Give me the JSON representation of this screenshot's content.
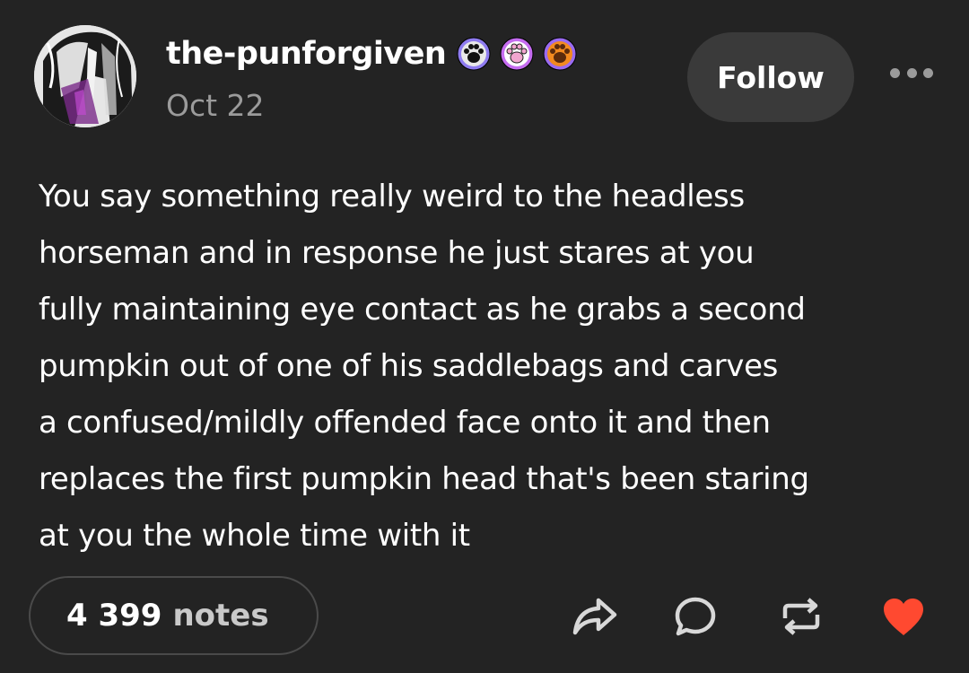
{
  "post": {
    "author": {
      "username": "the-punforgiven",
      "date": "Oct 22",
      "badges": [
        {
          "icon": "paw-badge-black",
          "bg": "#8f7cf0",
          "paw": "#111111"
        },
        {
          "icon": "paw-badge-pink",
          "bg": "#c56cf0",
          "paw": "#f2a6cf"
        },
        {
          "icon": "paw-badge-orange",
          "bg": "#9a6bf0",
          "paw": "#a3541b"
        }
      ]
    },
    "follow_label": "Follow",
    "more_icon": "more-options-icon",
    "body_lines": [
      "You say something really weird to the headless",
      "horseman and in response he just stares at you",
      "fully maintaining eye contact as he grabs a second",
      "pumpkin out of one of his saddlebags and carves",
      "a confused/mildly offended face onto it and then",
      "replaces the first pumpkin head that's been staring",
      "at you the whole time with it"
    ],
    "notes": {
      "count": "4 399",
      "label": "notes"
    },
    "actions": [
      {
        "icon": "share-icon"
      },
      {
        "icon": "reply-icon"
      },
      {
        "icon": "reblog-icon"
      },
      {
        "icon": "like-heart-icon",
        "color": "#ff4930"
      }
    ]
  },
  "colors": {
    "background": "#232323",
    "text": "#ffffff",
    "muted": "#9b9b9b",
    "button_bg": "#3a3a3a",
    "like": "#ff4930"
  }
}
